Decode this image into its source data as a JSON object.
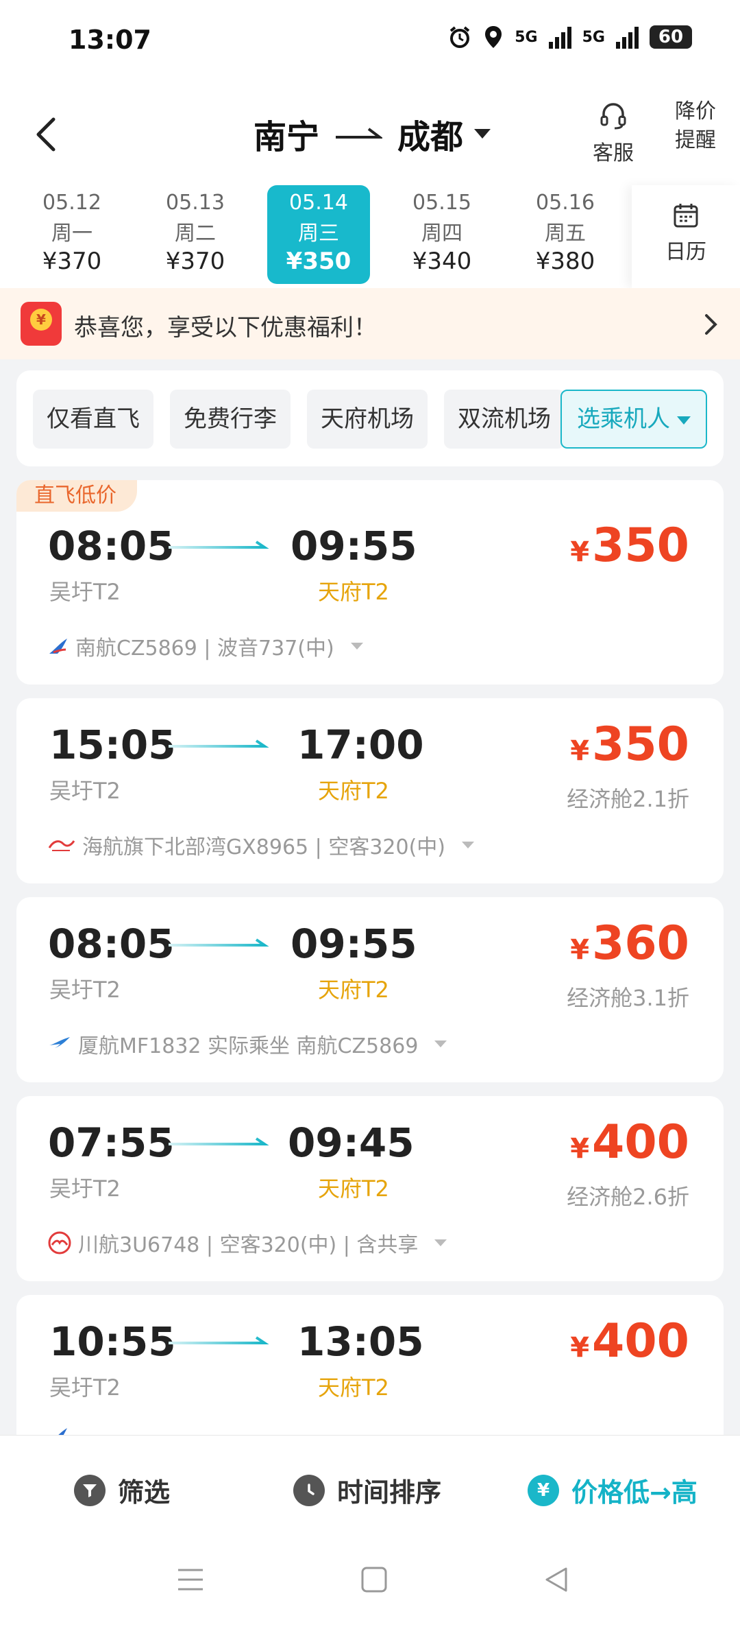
{
  "status": {
    "time": "13:07",
    "battery": "60",
    "net1": "5G",
    "net2": "5G"
  },
  "header": {
    "origin": "南宁",
    "destination": "成都",
    "service_label": "客服",
    "alert_line1": "降价",
    "alert_line2": "提醒"
  },
  "dates": [
    {
      "date": "05.12",
      "weekday": "周一",
      "price": "¥370"
    },
    {
      "date": "05.13",
      "weekday": "周二",
      "price": "¥370"
    },
    {
      "date": "05.14",
      "weekday": "周三",
      "price": "¥350"
    },
    {
      "date": "05.15",
      "weekday": "周四",
      "price": "¥340"
    },
    {
      "date": "05.16",
      "weekday": "周五",
      "price": "¥380"
    }
  ],
  "calendar_label": "日历",
  "promo": {
    "text": "恭喜您，享受以下优惠福利！",
    "icon_char": "¥"
  },
  "filters": {
    "direct": "仅看直飞",
    "free_baggage": "免费行李",
    "tianfu": "天府机场",
    "shuangliu": "双流机场",
    "passenger": "选乘机人"
  },
  "flights": [
    {
      "tag": "直飞低价",
      "dep_time": "08:05",
      "arr_time": "09:55",
      "dep_airport": "吴圩T2",
      "arr_airport": "天府T2",
      "price": "350",
      "cabin": "",
      "airline": "南航CZ5869 | 波音737(中)"
    },
    {
      "tag": "",
      "dep_time": "15:05",
      "arr_time": "17:00",
      "dep_airport": "吴圩T2",
      "arr_airport": "天府T2",
      "price": "350",
      "cabin": "经济舱2.1折",
      "airline": "海航旗下北部湾GX8965 | 空客320(中)"
    },
    {
      "tag": "",
      "dep_time": "08:05",
      "arr_time": "09:55",
      "dep_airport": "吴圩T2",
      "arr_airport": "天府T2",
      "price": "360",
      "cabin": "经济舱3.1折",
      "airline": "厦航MF1832 实际乘坐 南航CZ5869"
    },
    {
      "tag": "",
      "dep_time": "07:55",
      "arr_time": "09:45",
      "dep_airport": "吴圩T2",
      "arr_airport": "天府T2",
      "price": "400",
      "cabin": "经济舱2.6折",
      "airline": "川航3U6748 | 空客320(中) | 含共享"
    },
    {
      "tag": "",
      "dep_time": "10:55",
      "arr_time": "13:05",
      "dep_airport": "吴圩T2",
      "arr_airport": "天府T2",
      "price": "400",
      "cabin": "",
      "airline": ""
    }
  ],
  "bottom": {
    "filter_label": "筛选",
    "time_sort_label": "时间排序",
    "price_sort_label": "价格低→高",
    "price_icon_char": "¥"
  },
  "currency_symbol": "¥",
  "colors": {
    "accent": "#18b9cc",
    "price": "#ee4422",
    "arrive": "#e6a40c"
  }
}
